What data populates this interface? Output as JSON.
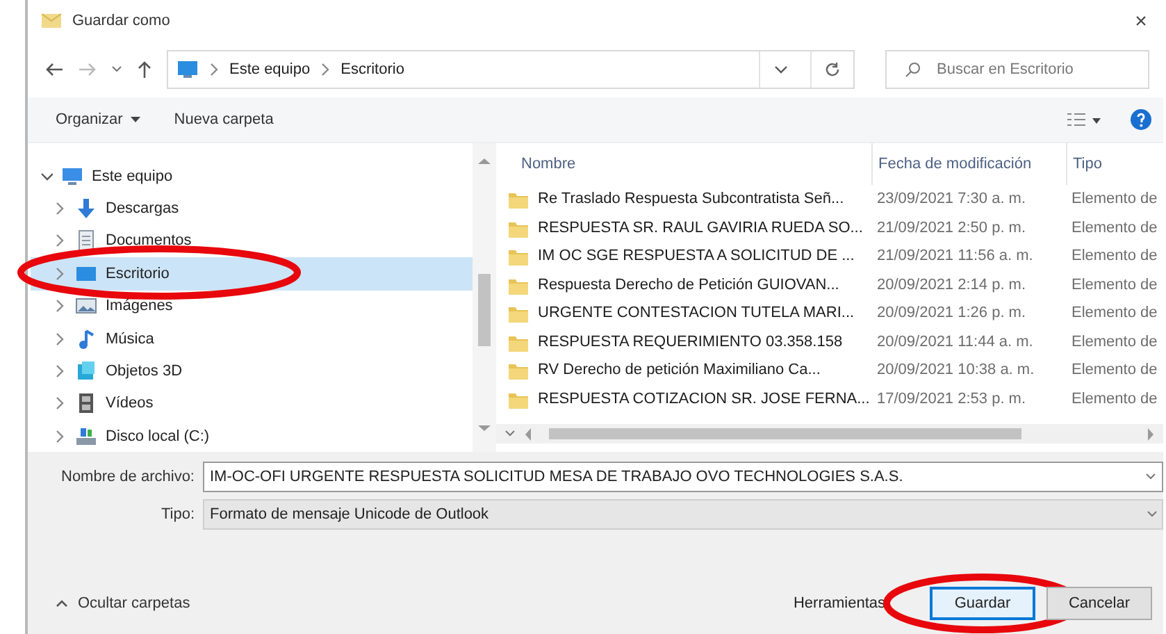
{
  "window": {
    "title": "Guardar como",
    "close": "×"
  },
  "address": {
    "path": [
      "Este equipo",
      "Escritorio"
    ]
  },
  "search": {
    "placeholder": "Buscar en Escritorio"
  },
  "toolbar": {
    "organize": "Organizar",
    "new_folder": "Nueva carpeta"
  },
  "nav": {
    "items": [
      {
        "label": "Este equipo",
        "kind": "pc",
        "expanded": true,
        "selected": false,
        "circled": false,
        "children": [
          {
            "label": "Descargas",
            "kind": "downloads",
            "expanded": false,
            "selected": false,
            "circled": false
          },
          {
            "label": "Documentos",
            "kind": "documents",
            "expanded": false,
            "selected": false,
            "circled": false
          },
          {
            "label": "Escritorio",
            "kind": "desktop",
            "expanded": false,
            "selected": true,
            "circled": true
          },
          {
            "label": "Imágenes",
            "kind": "pictures",
            "expanded": false,
            "selected": false,
            "circled": false
          },
          {
            "label": "Música",
            "kind": "music",
            "expanded": false,
            "selected": false,
            "circled": false
          },
          {
            "label": "Objetos 3D",
            "kind": "objects",
            "expanded": false,
            "selected": false,
            "circled": false
          },
          {
            "label": "Vídeos",
            "kind": "videos",
            "expanded": false,
            "selected": false,
            "circled": false
          },
          {
            "label": "Disco local (C:)",
            "kind": "drive",
            "expanded": false,
            "selected": false,
            "circled": false
          }
        ]
      }
    ]
  },
  "files": {
    "columns": [
      "Nombre",
      "Fecha de modificación",
      "Tipo"
    ],
    "rows": [
      {
        "name": "Re Traslado Respuesta Subcontratista Señ...",
        "date": "23/09/2021 7:30 a. m.",
        "type": "Elemento de"
      },
      {
        "name": "RESPUESTA SR. RAUL GAVIRIA RUEDA  SO...",
        "date": "21/09/2021 2:50 p. m.",
        "type": "Elemento de"
      },
      {
        "name": "IM OC SGE RESPUESTA A SOLICITUD DE ...",
        "date": "21/09/2021 11:56 a. m.",
        "type": "Elemento de"
      },
      {
        "name": "Respuesta Derecho de Petición GUIOVAN...",
        "date": "20/09/2021 2:14 p. m.",
        "type": "Elemento de"
      },
      {
        "name": "URGENTE CONTESTACION TUTELA  MARI...",
        "date": "20/09/2021 1:26 p. m.",
        "type": "Elemento de"
      },
      {
        "name": "RESPUESTA REQUERIMIENTO 03.358.158",
        "date": "20/09/2021 11:44 a. m.",
        "type": "Elemento de"
      },
      {
        "name": "RV Derecho de petición Maximiliano Ca...",
        "date": "20/09/2021 10:38 a. m.",
        "type": "Elemento de"
      },
      {
        "name": "RESPUESTA COTIZACION SR. JOSE FERNA...",
        "date": "17/09/2021 2:53 p. m.",
        "type": "Elemento de"
      }
    ]
  },
  "filename": {
    "label": "Nombre de archivo:",
    "value": "IM-OC-OFI URGENTE RESPUESTA SOLICITUD MESA DE TRABAJO OVO TECHNOLOGIES S.A.S."
  },
  "filetype": {
    "label": "Tipo:",
    "value": "Formato de mensaje Unicode de Outlook"
  },
  "hide_folders": "Ocultar carpetas",
  "buttons": [
    {
      "label": "Herramientas",
      "kind": "text",
      "circled": false
    },
    {
      "label": "Guardar",
      "kind": "primary",
      "circled": true
    },
    {
      "label": "Cancelar",
      "kind": "normal",
      "circled": false
    }
  ]
}
